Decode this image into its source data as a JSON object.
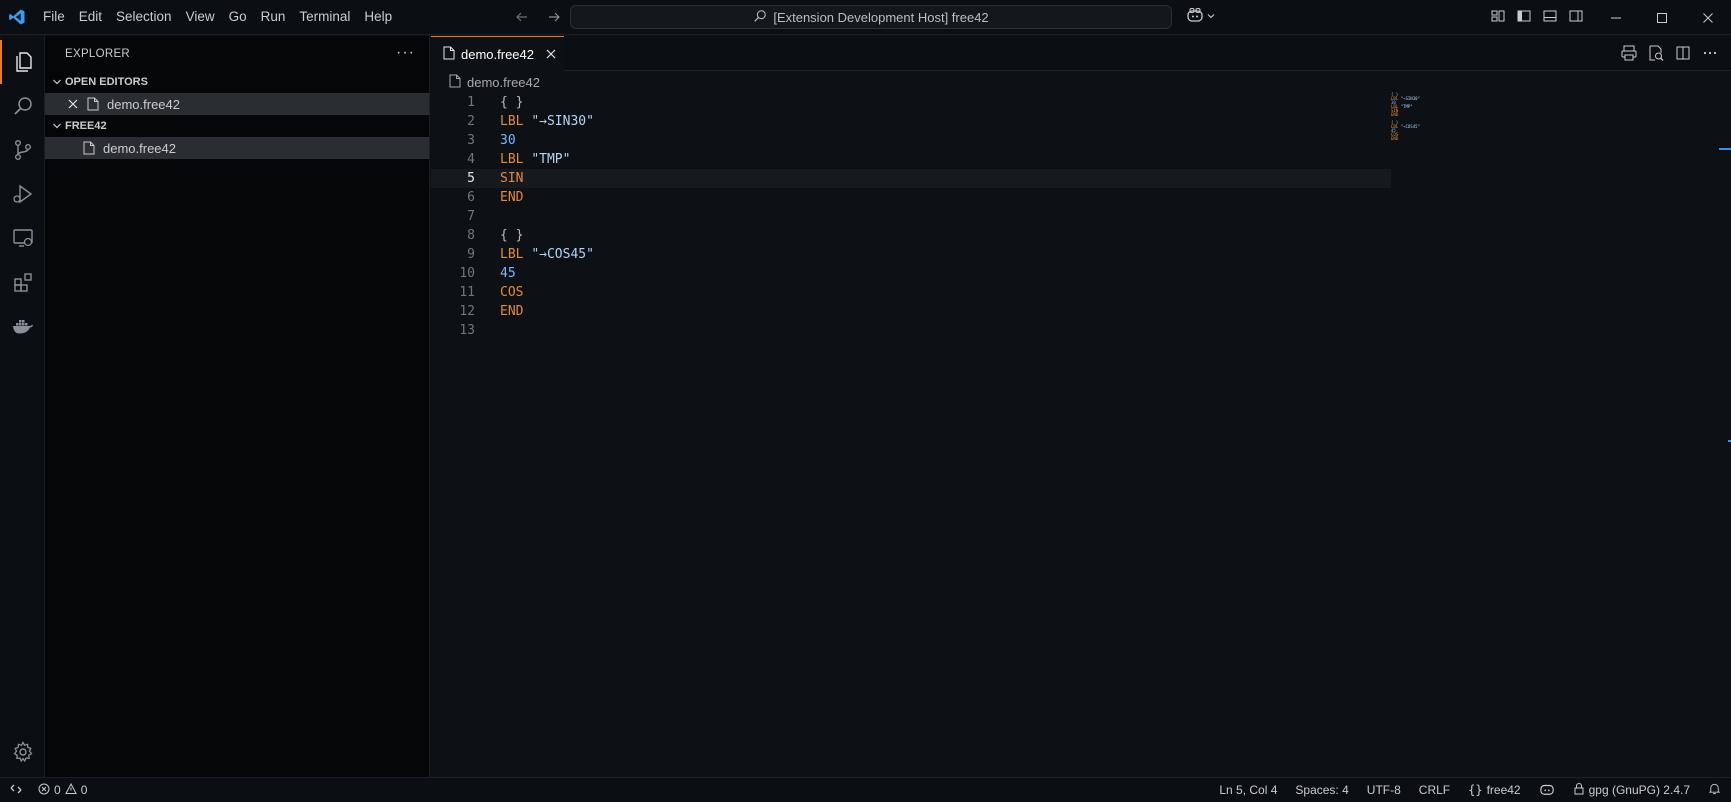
{
  "menu": [
    "File",
    "Edit",
    "Selection",
    "View",
    "Go",
    "Run",
    "Terminal",
    "Help"
  ],
  "command_center": {
    "text": "[Extension Development Host] free42"
  },
  "sidebar": {
    "title": "EXPLORER",
    "more": "···",
    "open_editors": {
      "label": "OPEN EDITORS",
      "items": [
        {
          "name": "demo.free42"
        }
      ]
    },
    "folder": {
      "label": "FREE42",
      "items": [
        {
          "name": "demo.free42"
        }
      ]
    }
  },
  "tab": {
    "label": "demo.free42"
  },
  "breadcrumb": {
    "file": "demo.free42"
  },
  "code_lines": [
    {
      "n": "1",
      "tokens": [
        {
          "t": "{ }",
          "c": "punc"
        }
      ]
    },
    {
      "n": "2",
      "tokens": [
        {
          "t": "LBL",
          "c": "kw"
        },
        {
          "t": " ",
          "c": "punc"
        },
        {
          "t": "\"→SIN30\"",
          "c": "str"
        }
      ]
    },
    {
      "n": "3",
      "tokens": [
        {
          "t": "30",
          "c": "num"
        }
      ]
    },
    {
      "n": "4",
      "tokens": [
        {
          "t": "LBL",
          "c": "kw"
        },
        {
          "t": " ",
          "c": "punc"
        },
        {
          "t": "\"TMP\"",
          "c": "str"
        }
      ]
    },
    {
      "n": "5",
      "tokens": [
        {
          "t": "SIN",
          "c": "kw"
        }
      ]
    },
    {
      "n": "6",
      "tokens": [
        {
          "t": "END",
          "c": "kw"
        }
      ]
    },
    {
      "n": "7",
      "tokens": []
    },
    {
      "n": "8",
      "tokens": [
        {
          "t": "{ }",
          "c": "punc"
        }
      ]
    },
    {
      "n": "9",
      "tokens": [
        {
          "t": "LBL",
          "c": "kw"
        },
        {
          "t": " ",
          "c": "punc"
        },
        {
          "t": "\"→COS45\"",
          "c": "str"
        }
      ]
    },
    {
      "n": "10",
      "tokens": [
        {
          "t": "45",
          "c": "num"
        }
      ]
    },
    {
      "n": "11",
      "tokens": [
        {
          "t": "COS",
          "c": "kw"
        }
      ]
    },
    {
      "n": "12",
      "tokens": [
        {
          "t": "END",
          "c": "kw"
        }
      ]
    },
    {
      "n": "13",
      "tokens": []
    }
  ],
  "current_line": "5",
  "status": {
    "errors": "0",
    "warnings": "0",
    "position": "Ln 5, Col 4",
    "spaces": "Spaces: 4",
    "encoding": "UTF-8",
    "eol": "CRLF",
    "language": "free42",
    "gpg": "gpg (GnuPG) 2.4.7"
  },
  "colors": {
    "accent": "#e67e22",
    "keyword": "#e68a3a",
    "number": "#79b8ff",
    "string": "#b4d4f4",
    "link": "#3b8eea"
  }
}
